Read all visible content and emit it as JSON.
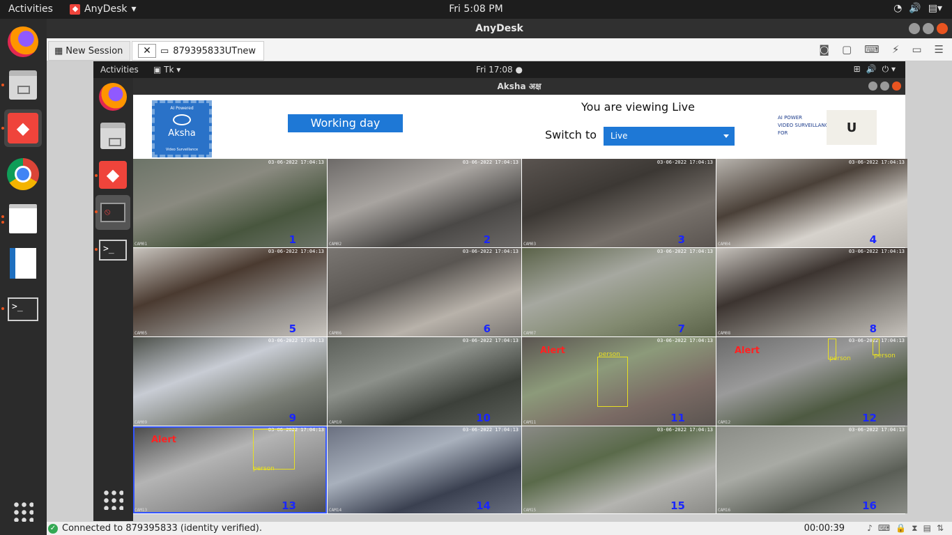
{
  "topbar": {
    "activities": "Activities",
    "app_name": "AnyDesk",
    "clock": "Fri  5:08 PM"
  },
  "window": {
    "title": "AnyDesk"
  },
  "tabs": [
    {
      "label": "New Session"
    },
    {
      "label": "879395833UTnew"
    }
  ],
  "remote": {
    "topbar": {
      "activities": "Activities",
      "app": "Tk",
      "clock": "Fri 17:08 ●"
    },
    "window_title": "Aksha  अक्ष"
  },
  "aksha": {
    "logo": {
      "top": "AI Powered",
      "name": "Aksha",
      "bottom": "Video Surveillance"
    },
    "day_status": "Working day",
    "viewing_text": "You are viewing Live",
    "switch_label": "Switch to",
    "switch_value": "Live",
    "brand_lines": [
      "AI POWER",
      "VIDEO SURVEILLANCE",
      "FOR"
    ],
    "brand_logo": "U"
  },
  "cameras": [
    {
      "num": "1",
      "label": "CAM01",
      "ts": "03-06-2022 17:04:13",
      "colors": [
        "#6c7468",
        "#48563e",
        "#8a8a80"
      ]
    },
    {
      "num": "2",
      "label": "CAM02",
      "ts": "03-06-2022 17:04:13",
      "colors": [
        "#6d6a68",
        "#4a4846",
        "#a8a4a0"
      ]
    },
    {
      "num": "3",
      "label": "CAM03",
      "ts": "03-06-2022 17:04:13",
      "colors": [
        "#5a5450",
        "#76706a",
        "#3c3834"
      ]
    },
    {
      "num": "4",
      "label": "CAM04",
      "ts": "03-06-2022 17:04:13",
      "colors": [
        "#b8b4ae",
        "#d6d2cc",
        "#4a4038"
      ]
    },
    {
      "num": "5",
      "label": "CAM05",
      "ts": "03-06-2022 17:04:13",
      "colors": [
        "#c8c4be",
        "#8c8884",
        "#4a3a30"
      ]
    },
    {
      "num": "6",
      "label": "CAM06",
      "ts": "03-06-2022 17:04:13",
      "colors": [
        "#7a7672",
        "#b8b2aa",
        "#5a5652"
      ]
    },
    {
      "num": "7",
      "label": "CAM07",
      "ts": "03-06-2022 17:04:13",
      "colors": [
        "#5a6248",
        "#828a70",
        "#a6a8a0"
      ]
    },
    {
      "num": "8",
      "label": "CAM08",
      "ts": "03-06-2022 17:04:13",
      "colors": [
        "#c6c2bc",
        "#86827c",
        "#3c3430"
      ]
    },
    {
      "num": "9",
      "label": "CAM09",
      "ts": "03-06-2022 17:04:13",
      "colors": [
        "#4c504a",
        "#7c8078",
        "#c8ccd4"
      ]
    },
    {
      "num": "10",
      "label": "CAM10",
      "ts": "03-06-2022 17:04:13",
      "colors": [
        "#5c605a",
        "#3c403a",
        "#8c908a"
      ]
    },
    {
      "num": "11",
      "label": "CAM11",
      "ts": "03-06-2022 17:04:13",
      "colors": [
        "#5a5450",
        "#7a6a64",
        "#8c9a7a"
      ],
      "alert": "Alert",
      "box": true
    },
    {
      "num": "12",
      "label": "CAM12",
      "ts": "03-06-2022 17:04:13",
      "colors": [
        "#6a6a6a",
        "#4e5a42",
        "#9a9a9a"
      ],
      "alert": "Alert",
      "box": true
    },
    {
      "num": "13",
      "label": "CAM13",
      "ts": "03-06-2022 17:04:13",
      "colors": [
        "#4a4a4a",
        "#8a8a8a",
        "#b4b4b4"
      ],
      "alert": "Alert",
      "box": true
    },
    {
      "num": "14",
      "label": "CAM14",
      "ts": "03-06-2022 17:04:13",
      "colors": [
        "#6a7080",
        "#3a4050",
        "#a8b0bc"
      ]
    },
    {
      "num": "15",
      "label": "CAM15",
      "ts": "03-06-2022 17:04:13",
      "colors": [
        "#8a8a86",
        "#b4b4b0",
        "#5a6a4a"
      ]
    },
    {
      "num": "16",
      "label": "CAM16",
      "ts": "03-06-2022 17:04:13",
      "colors": [
        "#8a8c86",
        "#5a5e56",
        "#a8aaa4"
      ]
    }
  ],
  "person_label": "person",
  "status": {
    "text": "Connected to 879395833 (identity verified).",
    "time": "00:00:39"
  }
}
